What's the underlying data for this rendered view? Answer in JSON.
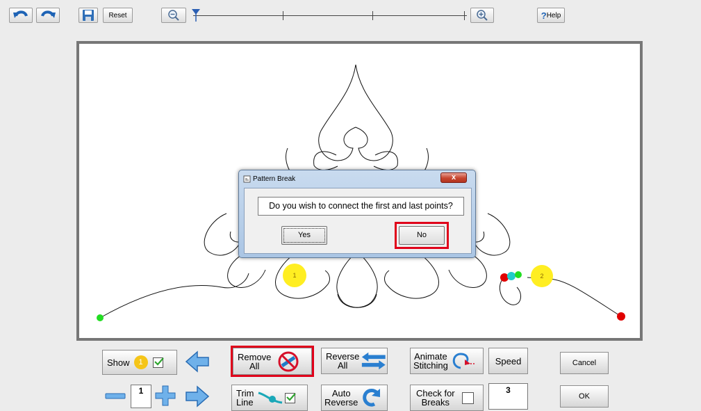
{
  "toolbar": {
    "reset_label": "Reset",
    "help_label": "Help",
    "help_mark": "?"
  },
  "dialog": {
    "title": "Pattern Break",
    "close_glyph": "x",
    "message": "Do you wish to connect the first and last points?",
    "yes_label": "Yes",
    "no_label": "No"
  },
  "canvas": {
    "markers": [
      "1",
      "2"
    ]
  },
  "controls": {
    "show_label": "Show",
    "show_badge": "1",
    "remove_all_label_1": "Remove",
    "remove_all_label_2": "All",
    "reverse_all_label_1": "Reverse",
    "reverse_all_label_2": "All",
    "animate_label_1": "Animate",
    "animate_label_2": "Stitching",
    "speed_label": "Speed",
    "cancel_label": "Cancel",
    "step_value": "1",
    "trim_line_label_1": "Trim",
    "trim_line_label_2": "Line",
    "auto_reverse_label_1": "Auto",
    "auto_reverse_label_2": "Reverse",
    "check_breaks_label_1": "Check for",
    "check_breaks_label_2": "Breaks",
    "speed_value": "3",
    "ok_label": "OK"
  },
  "colors": {
    "highlight": "#e0001a",
    "marker_yellow": "#ffee22",
    "point_green": "#22dd22",
    "point_red": "#e00000",
    "point_cyan": "#22cccc",
    "icon_blue": "#2a7fd0"
  }
}
